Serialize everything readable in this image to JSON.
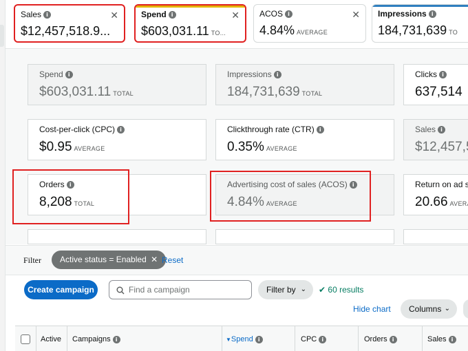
{
  "top_tiles": [
    {
      "label": "Sales",
      "value": "$12,457,518.9...",
      "suffix": "",
      "close": "✕"
    },
    {
      "label": "Spend",
      "value": "$603,031.11",
      "suffix": "TO...",
      "close": "✕"
    },
    {
      "label": "ACOS",
      "value": "4.84%",
      "suffix": "AVERAGE",
      "close": "✕"
    },
    {
      "label": "Impressions",
      "value": "184,731,639",
      "suffix": "TO",
      "close": ""
    }
  ],
  "metric_cards": {
    "spend": {
      "label": "Spend",
      "value": "$603,031.11",
      "suffix": "TOTAL"
    },
    "impressions": {
      "label": "Impressions",
      "value": "184,731,639",
      "suffix": "TOTAL"
    },
    "clicks": {
      "label": "Clicks",
      "value": "637,514",
      "suffix": ""
    },
    "cpc": {
      "label": "Cost-per-click (CPC)",
      "value": "$0.95",
      "suffix": "AVERAGE"
    },
    "ctr": {
      "label": "Clickthrough rate (CTR)",
      "value": "0.35%",
      "suffix": "AVERAGE"
    },
    "sales": {
      "label": "Sales",
      "value": "$12,457,5",
      "suffix": ""
    },
    "orders": {
      "label": "Orders",
      "value": "8,208",
      "suffix": "TOTAL"
    },
    "acos": {
      "label": "Advertising cost of sales (ACOS)",
      "value": "4.84%",
      "suffix": "AVERAGE"
    },
    "roas": {
      "label": "Return on ad sp",
      "value": "20.66",
      "suffix": "AVERAGE"
    }
  },
  "filter": {
    "label": "Filter",
    "chip": "Active status = Enabled",
    "chip_close": "✕",
    "reset": "Reset"
  },
  "toolbar": {
    "create_campaign": "Create campaign",
    "search_placeholder": "Find a campaign",
    "filter_by": "Filter by",
    "results": "60 results",
    "hide_chart": "Hide chart",
    "columns": "Columns"
  },
  "table_headers": {
    "active": "Active",
    "campaigns": "Campaigns",
    "spend": "Spend",
    "cpc": "CPC",
    "orders": "Orders",
    "sales": "Sales"
  },
  "colors": {
    "sales_bar": "#e67e22",
    "spend_bar": "#e4b400",
    "impressions_bar": "#2f7fbf",
    "highlight": "#e02020",
    "primary": "#0b6bc7"
  }
}
